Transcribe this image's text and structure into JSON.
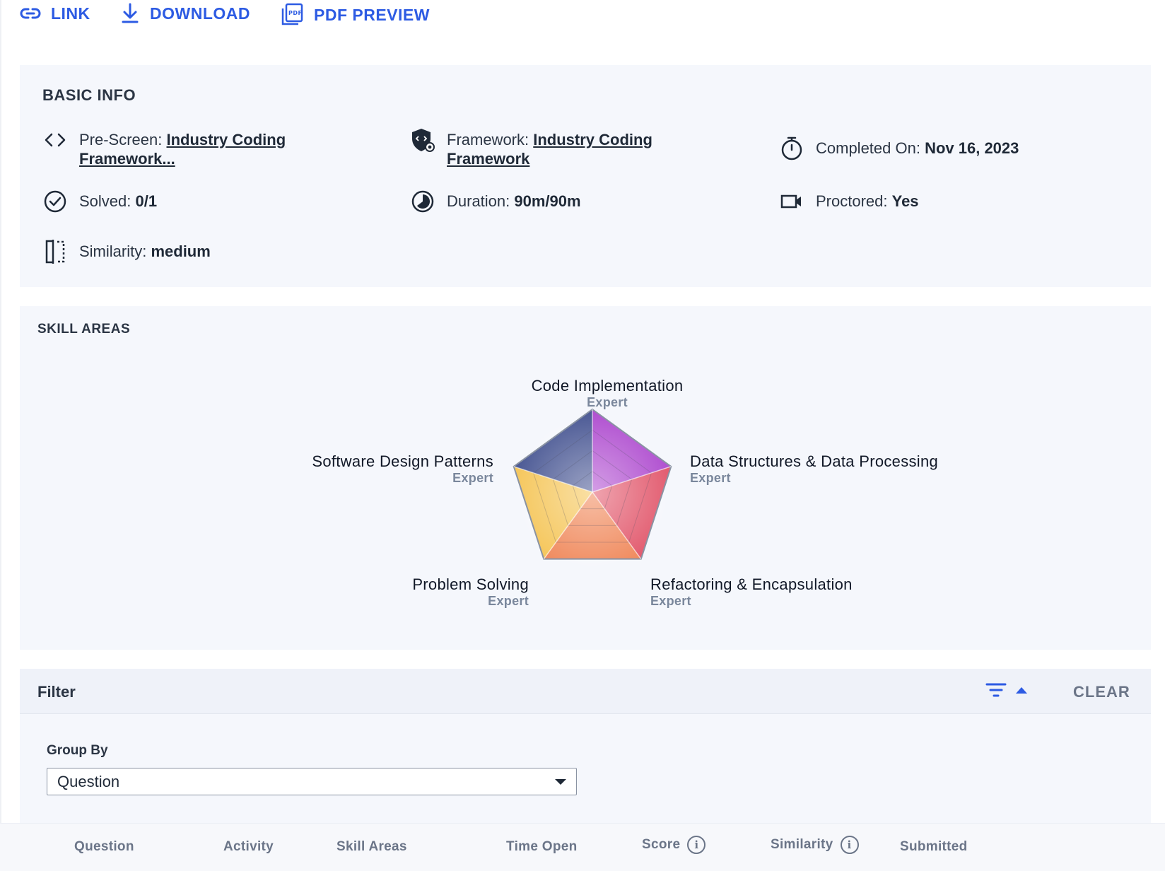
{
  "toolbar": {
    "link_label": "LINK",
    "download_label": "DOWNLOAD",
    "pdf_label": "PDF PREVIEW",
    "pdf_icon_text": "PDF"
  },
  "basic_info": {
    "title": "BASIC INFO",
    "prescreen": {
      "label": "Pre-Screen: ",
      "value_line1": "Industry Coding",
      "value_line2": "Framework..."
    },
    "framework": {
      "label": "Framework: ",
      "value_line1": "Industry Coding",
      "value_line2": "Framework"
    },
    "completed": {
      "label": "Completed On: ",
      "value": "Nov 16, 2023"
    },
    "solved": {
      "label": "Solved: ",
      "value": "0/1"
    },
    "duration": {
      "label": "Duration: ",
      "value": "90m/90m"
    },
    "proctored": {
      "label": "Proctored: ",
      "value": "Yes"
    },
    "similarity": {
      "label": "Similarity: ",
      "value": "medium"
    }
  },
  "skill_areas": {
    "title": "SKILL AREAS",
    "skills": [
      {
        "name": "Code Implementation",
        "level": "Expert",
        "color": "#b04fd0"
      },
      {
        "name": "Data Structures & Data Processing",
        "level": "Expert",
        "color": "#e25a6e"
      },
      {
        "name": "Refactoring & Encapsulation",
        "level": "Expert",
        "color": "#f08a5d"
      },
      {
        "name": "Problem Solving",
        "level": "Expert",
        "color": "#f5c65a"
      },
      {
        "name": "Software Design Patterns",
        "level": "Expert",
        "color": "#4a5894"
      }
    ]
  },
  "filter": {
    "title": "Filter",
    "clear_label": "CLEAR",
    "group_by_label": "Group By",
    "group_by_value": "Question"
  },
  "table": {
    "columns": [
      "Question",
      "Activity",
      "Skill Areas",
      "Time Open",
      "Score",
      "Similarity",
      "Submitted"
    ],
    "info_glyph": "i"
  },
  "colors": {
    "accent": "#2d5be3",
    "card_bg": "#f5f7fc"
  }
}
